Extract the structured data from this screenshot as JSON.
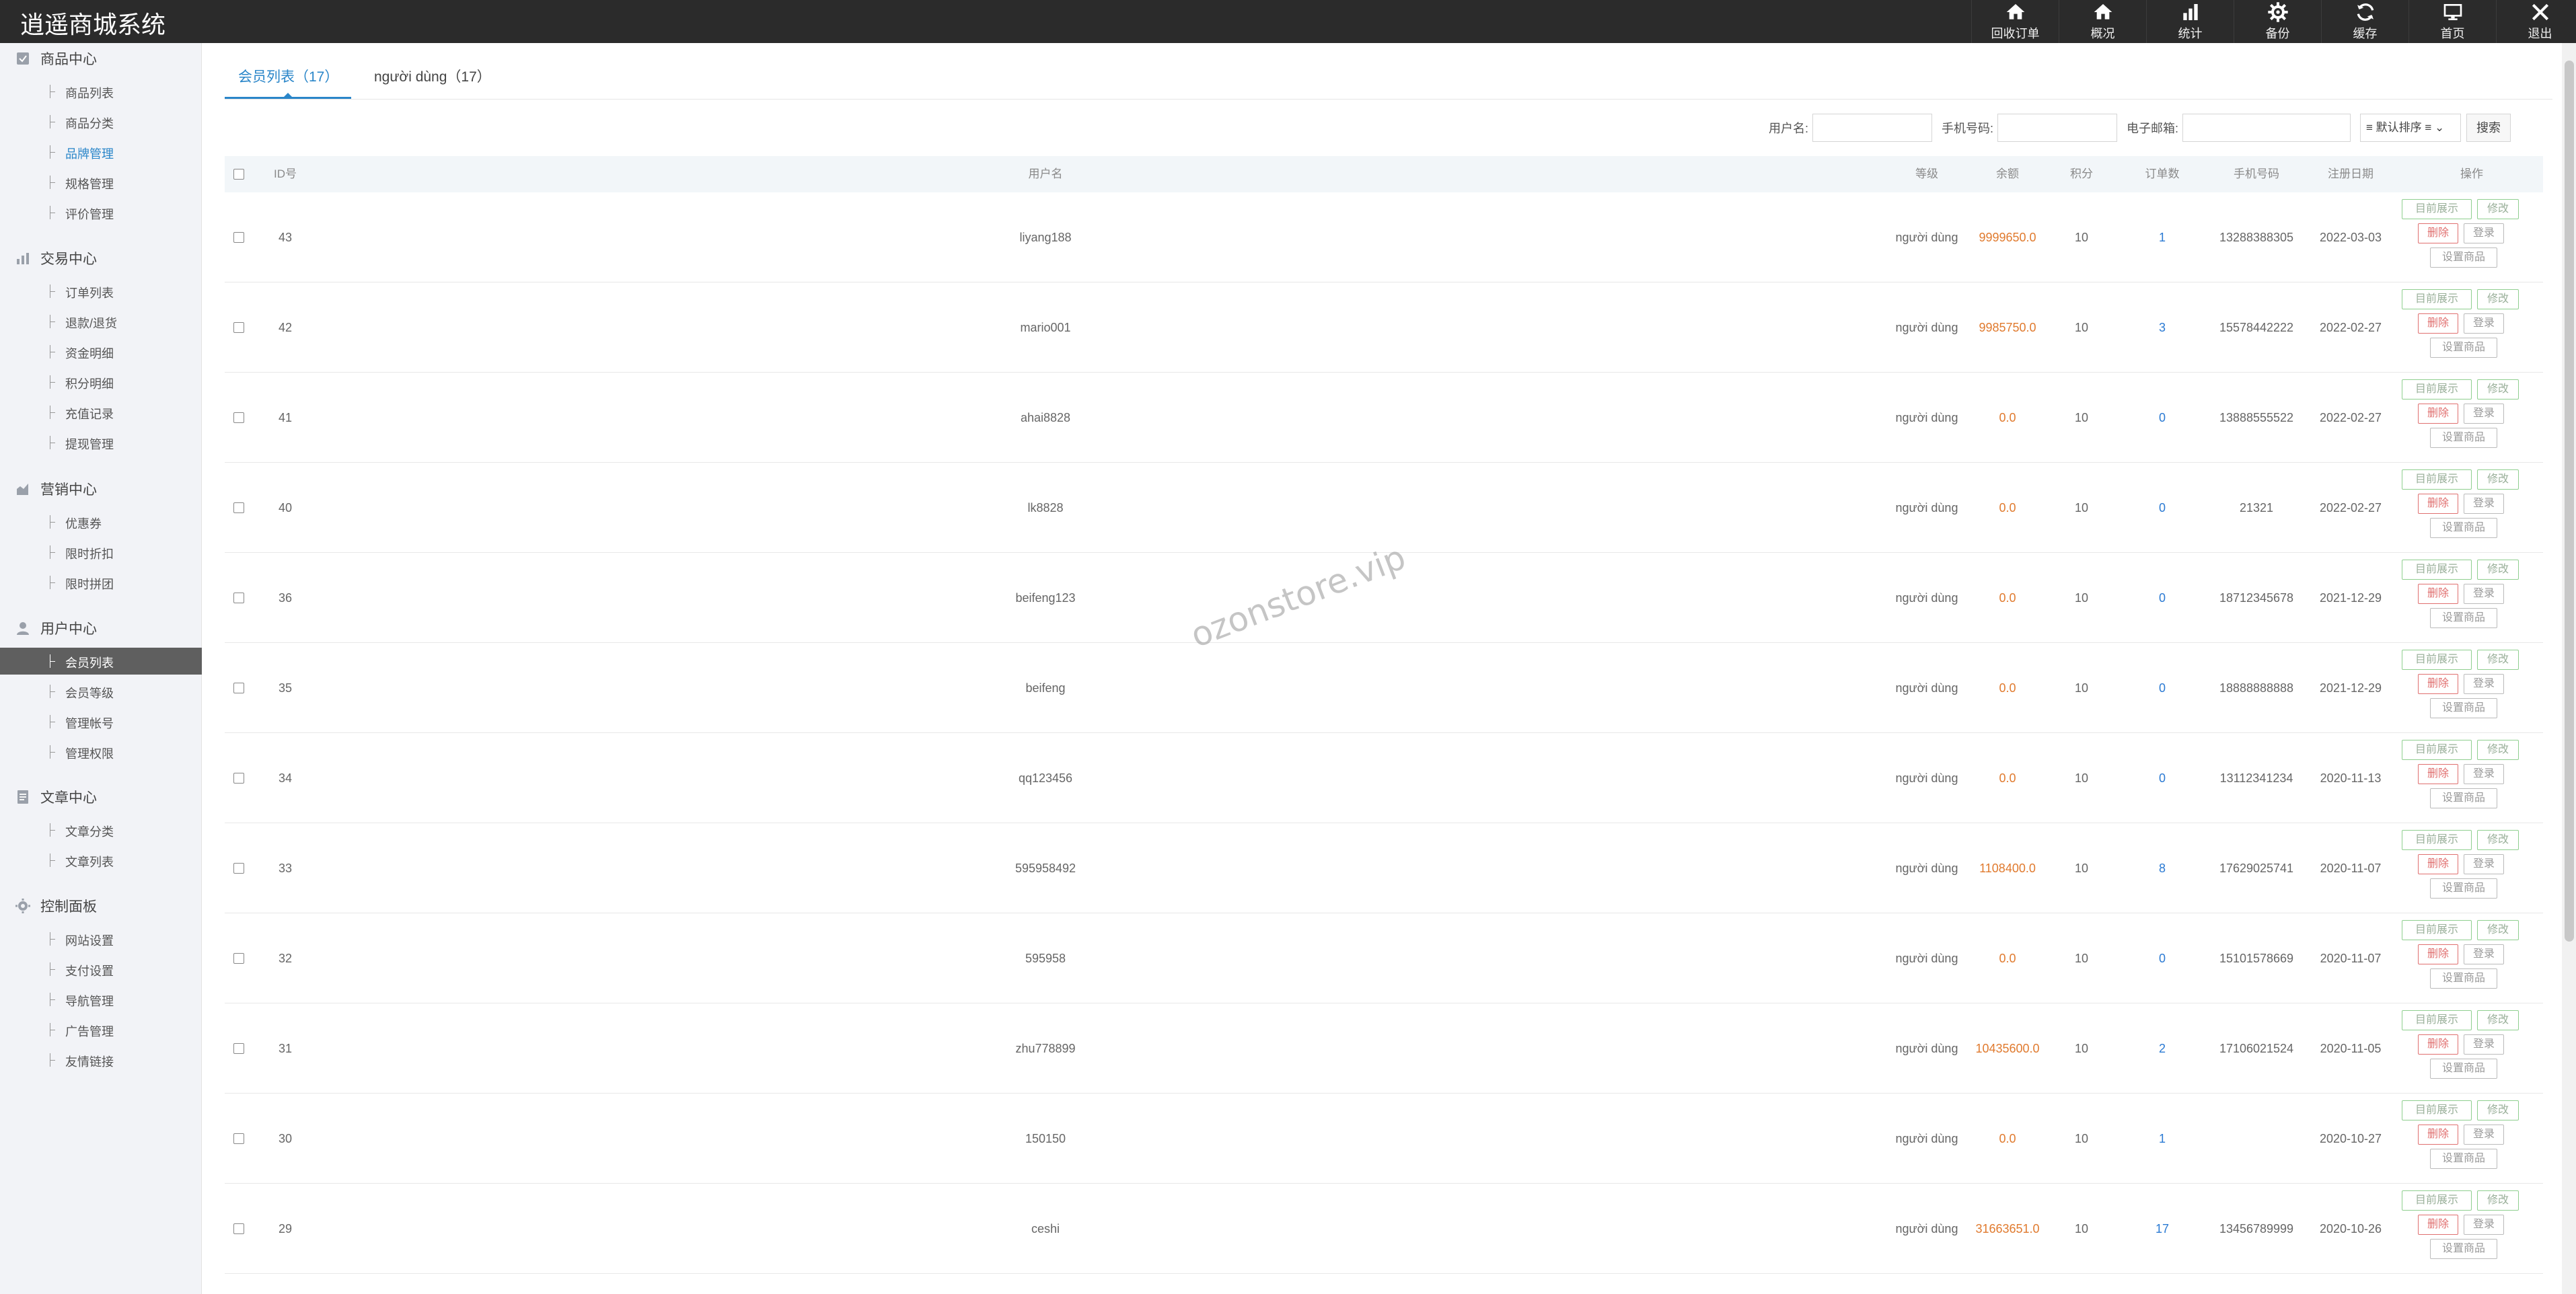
{
  "app": {
    "title": "逍遥商城系统"
  },
  "topnav": [
    {
      "label": "回收订单",
      "icon": "home-icon"
    },
    {
      "label": "概况",
      "icon": "home-icon"
    },
    {
      "label": "统计",
      "icon": "bar-chart-icon"
    },
    {
      "label": "备份",
      "icon": "gear-icon"
    },
    {
      "label": "缓存",
      "icon": "refresh-icon"
    },
    {
      "label": "首页",
      "icon": "monitor-icon"
    },
    {
      "label": "退出",
      "icon": "close-icon"
    }
  ],
  "sidebar": {
    "groups": [
      {
        "title": "商品中心",
        "icon": "product-icon",
        "items": [
          "商品列表",
          "商品分类",
          "品牌管理",
          "规格管理",
          "评价管理"
        ]
      },
      {
        "title": "交易中心",
        "icon": "bar-chart-icon",
        "items": [
          "订单列表",
          "退款/退货",
          "资金明细",
          "积分明细",
          "充值记录",
          "提现管理"
        ]
      },
      {
        "title": "营销中心",
        "icon": "chart-area-icon",
        "items": [
          "优惠券",
          "限时折扣",
          "限时拼团"
        ]
      },
      {
        "title": "用户中心",
        "icon": "user-icon",
        "items": [
          "会员列表",
          "会员等级",
          "管理帐号",
          "管理权限"
        ]
      },
      {
        "title": "文章中心",
        "icon": "document-icon",
        "items": [
          "文章分类",
          "文章列表"
        ]
      },
      {
        "title": "控制面板",
        "icon": "gear-icon",
        "items": [
          "网站设置",
          "支付设置",
          "导航管理",
          "广告管理",
          "友情链接"
        ]
      }
    ],
    "active_item": "会员列表",
    "highlight_item": "品牌管理"
  },
  "tabs": [
    {
      "label": "会员列表（17）",
      "active": true
    },
    {
      "label": "người dùng（17）",
      "active": false
    }
  ],
  "search": {
    "username_label": "用户名:",
    "phone_label": "手机号码:",
    "email_label": "电子邮箱:",
    "sort_value": "≡ 默认排序 ≡",
    "button": "搜索"
  },
  "table": {
    "headers": {
      "id": "ID号",
      "username": "用户名",
      "level": "等级",
      "balance": "余额",
      "points": "积分",
      "orders": "订单数",
      "phone": "手机号码",
      "date": "注册日期",
      "ops": "操作"
    },
    "op_labels": {
      "show": "目前展示",
      "edit": "修改",
      "delete": "删除",
      "login": "登录",
      "set": "设置商品"
    },
    "rows": [
      {
        "id": "43",
        "username": "liyang188",
        "level": "người dùng",
        "balance": "9999650.0",
        "points": "10",
        "orders": "1",
        "phone": "13288388305",
        "date": "2022-03-03"
      },
      {
        "id": "42",
        "username": "mario001",
        "level": "người dùng",
        "balance": "9985750.0",
        "points": "10",
        "orders": "3",
        "phone": "15578442222",
        "date": "2022-02-27"
      },
      {
        "id": "41",
        "username": "ahai8828",
        "level": "người dùng",
        "balance": "0.0",
        "points": "10",
        "orders": "0",
        "phone": "13888555522",
        "date": "2022-02-27"
      },
      {
        "id": "40",
        "username": "lk8828",
        "level": "người dùng",
        "balance": "0.0",
        "points": "10",
        "orders": "0",
        "phone": "21321",
        "date": "2022-02-27"
      },
      {
        "id": "36",
        "username": "beifeng123",
        "level": "người dùng",
        "balance": "0.0",
        "points": "10",
        "orders": "0",
        "phone": "18712345678",
        "date": "2021-12-29"
      },
      {
        "id": "35",
        "username": "beifeng",
        "level": "người dùng",
        "balance": "0.0",
        "points": "10",
        "orders": "0",
        "phone": "18888888888",
        "date": "2021-12-29"
      },
      {
        "id": "34",
        "username": "qq123456",
        "level": "người dùng",
        "balance": "0.0",
        "points": "10",
        "orders": "0",
        "phone": "13112341234",
        "date": "2020-11-13"
      },
      {
        "id": "33",
        "username": "595958492",
        "level": "người dùng",
        "balance": "1108400.0",
        "points": "10",
        "orders": "8",
        "phone": "17629025741",
        "date": "2020-11-07"
      },
      {
        "id": "32",
        "username": "595958",
        "level": "người dùng",
        "balance": "0.0",
        "points": "10",
        "orders": "0",
        "phone": "15101578669",
        "date": "2020-11-07"
      },
      {
        "id": "31",
        "username": "zhu778899",
        "level": "người dùng",
        "balance": "10435600.0",
        "points": "10",
        "orders": "2",
        "phone": "17106021524",
        "date": "2020-11-05"
      },
      {
        "id": "30",
        "username": "150150",
        "level": "người dùng",
        "balance": "0.0",
        "points": "10",
        "orders": "1",
        "phone": "",
        "date": "2020-10-27"
      },
      {
        "id": "29",
        "username": "ceshi",
        "level": "người dùng",
        "balance": "31663651.0",
        "points": "10",
        "orders": "17",
        "phone": "13456789999",
        "date": "2020-10-26"
      }
    ]
  },
  "watermark": "ozonstore.vip",
  "colors": {
    "accent": "#2a86c9",
    "balance": "#e07a2e",
    "topbar": "#2b2b2b",
    "active_sidebar": "#5f5f5f"
  }
}
